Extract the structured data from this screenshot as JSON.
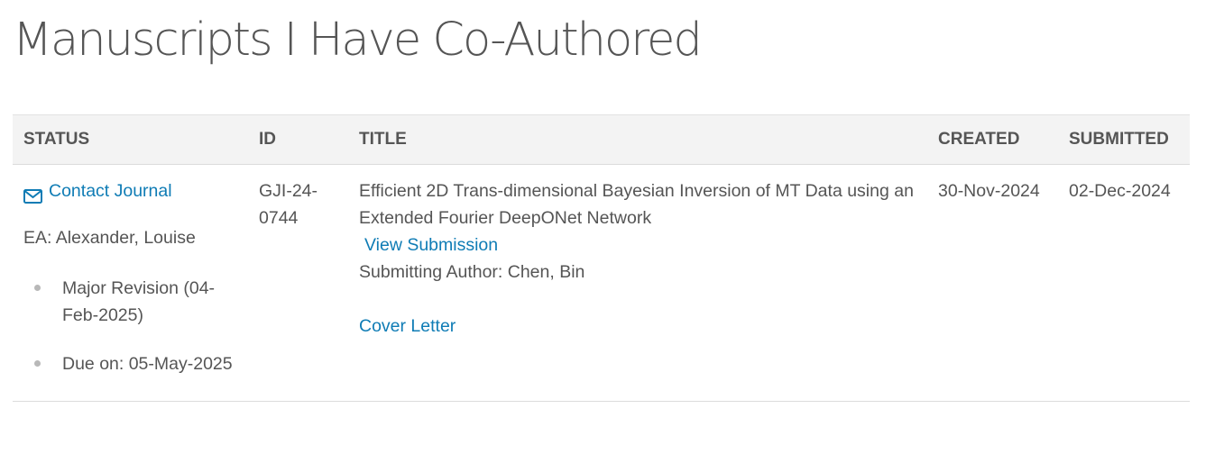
{
  "page": {
    "title": "Manuscripts I Have Co-Authored"
  },
  "table": {
    "headers": {
      "status": "STATUS",
      "id": "ID",
      "title": "TITLE",
      "created": "CREATED",
      "submitted": "SUBMITTED"
    },
    "rows": [
      {
        "contact_label": "Contact Journal",
        "contact_icon": "envelope-icon",
        "editor": "EA: Alexander, Louise",
        "status_items": [
          "Major Revision (04-Feb-2025)",
          "Due on: 05-May-2025"
        ],
        "id": "GJI-24-0744",
        "title": "Efficient 2D Trans-dimensional Bayesian Inversion of MT Data using an Extended Fourier DeepONet Network",
        "view_submission_label": "View Submission",
        "submitting_author": "Submitting Author: Chen, Bin",
        "cover_letter_label": "Cover Letter",
        "created": "30-Nov-2024",
        "submitted": "02-Dec-2024"
      }
    ]
  },
  "colors": {
    "link": "#0f7cb5",
    "text": "#555555",
    "header_bg": "#f3f3f3",
    "border": "#dcdcdc"
  }
}
